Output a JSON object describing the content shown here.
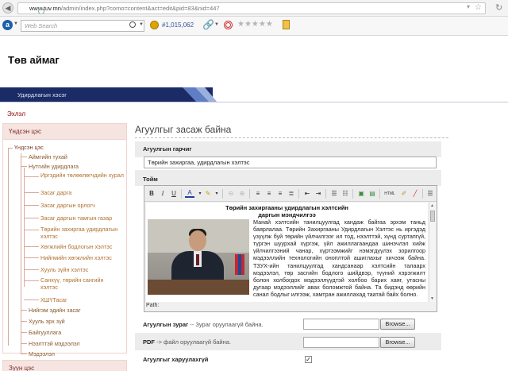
{
  "browser": {
    "url_host": "www.tuv.mn",
    "url_path": "/admin/index.php?como=content&act=edit&pid=83&nid=447",
    "search_placeholder": "Web Search",
    "counter": "#1,015,062"
  },
  "site": {
    "title": "Төв аймаг",
    "nav_item": "Удирдлагын хэсэг",
    "exit_link": "Эхлэл"
  },
  "sidebar": {
    "header": "Үндсэн цэс",
    "root": "Үндсэн цэс",
    "items": [
      {
        "label": "Аймгийн тухай"
      },
      {
        "label": "Нутгийн удирдлага"
      },
      {
        "label": "Иргэдийн төлөөлөгчдийн хурал"
      },
      {
        "label": "Засаг дарга"
      },
      {
        "label": "Засаг даргын орлогч"
      },
      {
        "label": "Засаг даргын тамгын газар"
      },
      {
        "label": "Төрийн захиргаа удирдлагын хэлтэс"
      },
      {
        "label": "Хөгжлийн бодлогын хэлтэс"
      },
      {
        "label": "Нийгмийн хөгжлийн хэлтэс"
      },
      {
        "label": "Хууль зүйн хэлтэс"
      },
      {
        "label": "Санхүү, төрийн сангийн хэлтэс"
      },
      {
        "label": "ХШҮТасаг"
      },
      {
        "label": "Нийгэм эдийн засаг"
      },
      {
        "label": "Хууль эрх зүй"
      },
      {
        "label": "Байгууллага"
      },
      {
        "label": "Нээлттэй мэдээлэл"
      },
      {
        "label": "Мэдээлэл"
      }
    ],
    "footer_header": "Зүүн цэс"
  },
  "main": {
    "page_title": "Агуулгыг засаж байна",
    "title_label": "Агуулгын гарчиг",
    "title_value": "Төрийн захиргаа, удирдлагын хэлтэс",
    "body_label": "Тойм",
    "editor": {
      "doc_title_line1": "Төрийн захиргааны удирдлагын хэлтсийн",
      "doc_title_line2": "даргын мэндчилгээ",
      "doc_body": "Манай хэлтсийн танилцуулгад хандаж байгаа эрхэм таньд баярлалаа. Төрийн Захиргааны Удирдлагын Хэлтэс нь иргэдэд үзүүлж буй төрийн үйлчилгээг ил тод, нээлттэй, хүнд суртапгүй, түргэн шуурхай хүргэж, үйл ажиллагаандаа шинэчлэл хийж үйлчилгээний чанар, хүртээмжийг нэмэгдүүлэх зорилгоор мэдээллийн технологийн оноплтой ашиглахыг хичээж байна. ТЗУХ-ийн танилцуулгад хандсанаар хэлтсийн талаарх мэдээлэл, төр засгийн бодлого шийдвэр, түүний хэрэгжилт болон холбогдох мэдээллүүдтэй холбоо барих хаяг, утасны дугаар мэдээллийг авах боломжтой байна. Та бидэнд өөрийн санал бодлыг илгээж, хамтран ажиллахад таатай байх болно.",
      "path_label": "Path:"
    },
    "image_label": "Агуулгын зураг",
    "image_hint": "-- Зураг оруулаагүй байна.",
    "pdf_label": "PDF",
    "pdf_hint": "-> файл оруулаагүй байна.",
    "browse_label": "Browse...",
    "visibility_label": "Агуулгыг харуулахгүй",
    "visibility_checked": "✓"
  }
}
